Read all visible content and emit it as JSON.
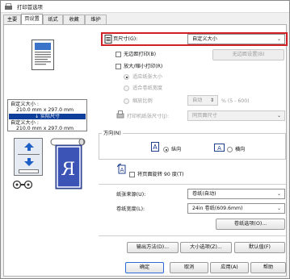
{
  "window": {
    "title": "打印首选项"
  },
  "tabs": [
    {
      "label": "主要",
      "active": false
    },
    {
      "label": "页设置",
      "active": true
    },
    {
      "label": "纸式",
      "active": false
    },
    {
      "label": "收藏",
      "active": false
    },
    {
      "label": "维护",
      "active": false
    }
  ],
  "preview": {
    "paper_label_1": "自定义大小 :",
    "paper_size_1": "210.0 mm x 297.0 mm",
    "actual_size": "↓ 实际尺寸",
    "paper_label_2": "自定义大小 :",
    "paper_size_2": "210.0 mm x 297.0 mm"
  },
  "page_size": {
    "label": "页尺寸(G):",
    "value": "自定义大小"
  },
  "borderless": {
    "label": "无边距打印(B)",
    "checked": false,
    "settings_button": "无边距设置(B)"
  },
  "enlarge_reduce": {
    "label": "放大/缩小打印(R)",
    "checked": false,
    "options": [
      {
        "label": "适应纸张大小",
        "selected": true
      },
      {
        "label": "适合卷纸宽度",
        "selected": false
      },
      {
        "label": "缩放比例",
        "selected": false
      }
    ],
    "scale_value": "自动",
    "scale_range": "% (5 - 600)",
    "output_size_label": "打印机纸张尺寸(J):",
    "output_size_value": "同页面尺寸"
  },
  "orientation": {
    "label": "方向(N)",
    "portrait": "纵向",
    "landscape": "横向",
    "selected": "portrait",
    "rotate_label": "将页面旋转 90 度(T)",
    "rotate_checked": false
  },
  "paper_source": {
    "label": "纸张来源(U):",
    "value": "卷纸(自动)"
  },
  "roll_width": {
    "label": "卷纸宽度(L):",
    "value": "24in 卷纸(609.6mm)"
  },
  "buttons": {
    "roll_options": "卷纸选项(O)...",
    "output_method": "输出方法(D)...",
    "size_options": "大小选项(Z)...",
    "defaults": "默认值(F)",
    "ok": "确定",
    "cancel": "取消",
    "apply": "应用(A)",
    "help": "帮助"
  },
  "colors": {
    "highlight": "#d11f26",
    "accent_blue": "#0e3f9a"
  }
}
